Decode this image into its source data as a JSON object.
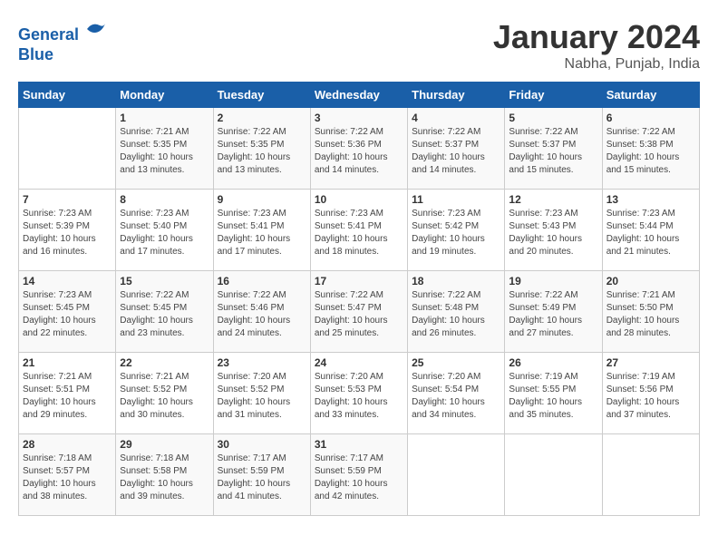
{
  "header": {
    "logo_line1": "General",
    "logo_line2": "Blue",
    "month": "January 2024",
    "location": "Nabha, Punjab, India"
  },
  "columns": [
    "Sunday",
    "Monday",
    "Tuesday",
    "Wednesday",
    "Thursday",
    "Friday",
    "Saturday"
  ],
  "weeks": [
    [
      {
        "day": "",
        "sunrise": "",
        "sunset": "",
        "daylight": ""
      },
      {
        "day": "1",
        "sunrise": "Sunrise: 7:21 AM",
        "sunset": "Sunset: 5:35 PM",
        "daylight": "Daylight: 10 hours and 13 minutes."
      },
      {
        "day": "2",
        "sunrise": "Sunrise: 7:22 AM",
        "sunset": "Sunset: 5:35 PM",
        "daylight": "Daylight: 10 hours and 13 minutes."
      },
      {
        "day": "3",
        "sunrise": "Sunrise: 7:22 AM",
        "sunset": "Sunset: 5:36 PM",
        "daylight": "Daylight: 10 hours and 14 minutes."
      },
      {
        "day": "4",
        "sunrise": "Sunrise: 7:22 AM",
        "sunset": "Sunset: 5:37 PM",
        "daylight": "Daylight: 10 hours and 14 minutes."
      },
      {
        "day": "5",
        "sunrise": "Sunrise: 7:22 AM",
        "sunset": "Sunset: 5:37 PM",
        "daylight": "Daylight: 10 hours and 15 minutes."
      },
      {
        "day": "6",
        "sunrise": "Sunrise: 7:22 AM",
        "sunset": "Sunset: 5:38 PM",
        "daylight": "Daylight: 10 hours and 15 minutes."
      }
    ],
    [
      {
        "day": "7",
        "sunrise": "Sunrise: 7:23 AM",
        "sunset": "Sunset: 5:39 PM",
        "daylight": "Daylight: 10 hours and 16 minutes."
      },
      {
        "day": "8",
        "sunrise": "Sunrise: 7:23 AM",
        "sunset": "Sunset: 5:40 PM",
        "daylight": "Daylight: 10 hours and 17 minutes."
      },
      {
        "day": "9",
        "sunrise": "Sunrise: 7:23 AM",
        "sunset": "Sunset: 5:41 PM",
        "daylight": "Daylight: 10 hours and 17 minutes."
      },
      {
        "day": "10",
        "sunrise": "Sunrise: 7:23 AM",
        "sunset": "Sunset: 5:41 PM",
        "daylight": "Daylight: 10 hours and 18 minutes."
      },
      {
        "day": "11",
        "sunrise": "Sunrise: 7:23 AM",
        "sunset": "Sunset: 5:42 PM",
        "daylight": "Daylight: 10 hours and 19 minutes."
      },
      {
        "day": "12",
        "sunrise": "Sunrise: 7:23 AM",
        "sunset": "Sunset: 5:43 PM",
        "daylight": "Daylight: 10 hours and 20 minutes."
      },
      {
        "day": "13",
        "sunrise": "Sunrise: 7:23 AM",
        "sunset": "Sunset: 5:44 PM",
        "daylight": "Daylight: 10 hours and 21 minutes."
      }
    ],
    [
      {
        "day": "14",
        "sunrise": "Sunrise: 7:23 AM",
        "sunset": "Sunset: 5:45 PM",
        "daylight": "Daylight: 10 hours and 22 minutes."
      },
      {
        "day": "15",
        "sunrise": "Sunrise: 7:22 AM",
        "sunset": "Sunset: 5:45 PM",
        "daylight": "Daylight: 10 hours and 23 minutes."
      },
      {
        "day": "16",
        "sunrise": "Sunrise: 7:22 AM",
        "sunset": "Sunset: 5:46 PM",
        "daylight": "Daylight: 10 hours and 24 minutes."
      },
      {
        "day": "17",
        "sunrise": "Sunrise: 7:22 AM",
        "sunset": "Sunset: 5:47 PM",
        "daylight": "Daylight: 10 hours and 25 minutes."
      },
      {
        "day": "18",
        "sunrise": "Sunrise: 7:22 AM",
        "sunset": "Sunset: 5:48 PM",
        "daylight": "Daylight: 10 hours and 26 minutes."
      },
      {
        "day": "19",
        "sunrise": "Sunrise: 7:22 AM",
        "sunset": "Sunset: 5:49 PM",
        "daylight": "Daylight: 10 hours and 27 minutes."
      },
      {
        "day": "20",
        "sunrise": "Sunrise: 7:21 AM",
        "sunset": "Sunset: 5:50 PM",
        "daylight": "Daylight: 10 hours and 28 minutes."
      }
    ],
    [
      {
        "day": "21",
        "sunrise": "Sunrise: 7:21 AM",
        "sunset": "Sunset: 5:51 PM",
        "daylight": "Daylight: 10 hours and 29 minutes."
      },
      {
        "day": "22",
        "sunrise": "Sunrise: 7:21 AM",
        "sunset": "Sunset: 5:52 PM",
        "daylight": "Daylight: 10 hours and 30 minutes."
      },
      {
        "day": "23",
        "sunrise": "Sunrise: 7:20 AM",
        "sunset": "Sunset: 5:52 PM",
        "daylight": "Daylight: 10 hours and 31 minutes."
      },
      {
        "day": "24",
        "sunrise": "Sunrise: 7:20 AM",
        "sunset": "Sunset: 5:53 PM",
        "daylight": "Daylight: 10 hours and 33 minutes."
      },
      {
        "day": "25",
        "sunrise": "Sunrise: 7:20 AM",
        "sunset": "Sunset: 5:54 PM",
        "daylight": "Daylight: 10 hours and 34 minutes."
      },
      {
        "day": "26",
        "sunrise": "Sunrise: 7:19 AM",
        "sunset": "Sunset: 5:55 PM",
        "daylight": "Daylight: 10 hours and 35 minutes."
      },
      {
        "day": "27",
        "sunrise": "Sunrise: 7:19 AM",
        "sunset": "Sunset: 5:56 PM",
        "daylight": "Daylight: 10 hours and 37 minutes."
      }
    ],
    [
      {
        "day": "28",
        "sunrise": "Sunrise: 7:18 AM",
        "sunset": "Sunset: 5:57 PM",
        "daylight": "Daylight: 10 hours and 38 minutes."
      },
      {
        "day": "29",
        "sunrise": "Sunrise: 7:18 AM",
        "sunset": "Sunset: 5:58 PM",
        "daylight": "Daylight: 10 hours and 39 minutes."
      },
      {
        "day": "30",
        "sunrise": "Sunrise: 7:17 AM",
        "sunset": "Sunset: 5:59 PM",
        "daylight": "Daylight: 10 hours and 41 minutes."
      },
      {
        "day": "31",
        "sunrise": "Sunrise: 7:17 AM",
        "sunset": "Sunset: 5:59 PM",
        "daylight": "Daylight: 10 hours and 42 minutes."
      },
      {
        "day": "",
        "sunrise": "",
        "sunset": "",
        "daylight": ""
      },
      {
        "day": "",
        "sunrise": "",
        "sunset": "",
        "daylight": ""
      },
      {
        "day": "",
        "sunrise": "",
        "sunset": "",
        "daylight": ""
      }
    ]
  ]
}
